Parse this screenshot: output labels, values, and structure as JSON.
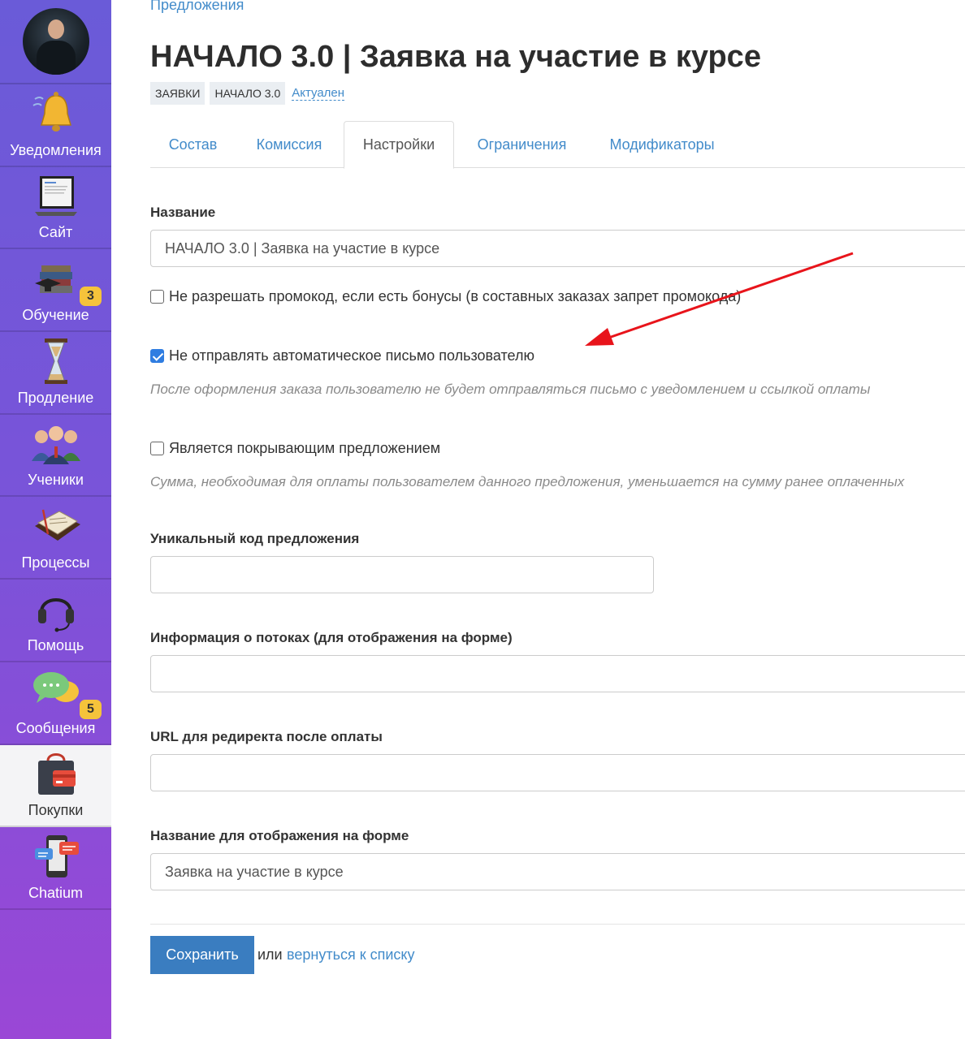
{
  "sidebar": {
    "items": [
      {
        "label": "Уведомления",
        "icon": "bell-icon"
      },
      {
        "label": "Сайт",
        "icon": "laptop-icon"
      },
      {
        "label": "Обучение",
        "icon": "books-icon",
        "badge": "3"
      },
      {
        "label": "Продление",
        "icon": "hourglass-icon"
      },
      {
        "label": "Ученики",
        "icon": "people-icon"
      },
      {
        "label": "Процессы",
        "icon": "papers-icon"
      },
      {
        "label": "Помощь",
        "icon": "headset-icon"
      },
      {
        "label": "Сообщения",
        "icon": "chat-icon",
        "badge": "5"
      },
      {
        "label": "Покупки",
        "icon": "shopping-bag-icon",
        "active": true
      },
      {
        "label": "Chatium",
        "icon": "phone-chat-icon"
      }
    ]
  },
  "header": {
    "breadcrumb": "Предложения",
    "title": "НАЧАЛО 3.0 | Заявка на участие в курсе",
    "tags": [
      "ЗАЯВКИ",
      "НАЧАЛО 3.0"
    ],
    "status_link": "Актуален"
  },
  "tabs": [
    "Состав",
    "Комиссия",
    "Настройки",
    "Ограничения",
    "Модификаторы"
  ],
  "active_tab": "Настройки",
  "form": {
    "name_label": "Название",
    "name_value": "НАЧАЛО 3.0 | Заявка на участие в курсе",
    "promo_checkbox": {
      "label": "Не разрешать промокод, если есть бонусы (в составных заказах запрет промокода)",
      "checked": false
    },
    "no_email_checkbox": {
      "label": "Не отправлять автоматическое письмо пользователю",
      "checked": true
    },
    "no_email_help": "После оформления заказа пользователю не будет отправляться письмо с уведомлением и ссылкой оплаты",
    "covering_checkbox": {
      "label": "Является покрывающим предложением",
      "checked": false
    },
    "covering_help": "Сумма, необходимая для оплаты пользователем данного предложения, уменьшается на сумму ранее оплаченных",
    "unique_code_label": "Уникальный код предложения",
    "unique_code_value": "",
    "streams_label": "Информация о потоках (для отображения на форме)",
    "streams_value": "",
    "redirect_label": "URL для редиректа после оплаты",
    "redirect_value": "",
    "display_name_label": "Название для отображения на форме",
    "display_name_value": "Заявка на участие в курсе"
  },
  "actions": {
    "save_label": "Сохранить",
    "or_text": "или",
    "back_link": "вернуться к списку"
  },
  "colors": {
    "accent": "#428bca",
    "annotation_arrow": "#e8141b",
    "sidebar_top": "#6a5bd8",
    "sidebar_bottom": "#9a47d6"
  }
}
